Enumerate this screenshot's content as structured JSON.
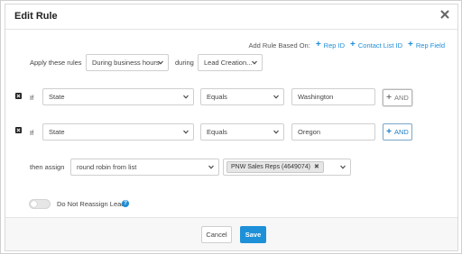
{
  "dialog": {
    "title": "Edit Rule"
  },
  "add_rule": {
    "label": "Add Rule Based On:",
    "links": [
      "Rep ID",
      "Contact List ID",
      "Rep Field"
    ]
  },
  "apply": {
    "label": "Apply these rules",
    "hours_value": "During business hours",
    "during_label": "during",
    "during_value": "Lead Creation..."
  },
  "conditions": [
    {
      "if_label": "If",
      "field": "State",
      "operator": "Equals",
      "value": "Washington",
      "and_label": "AND"
    },
    {
      "if_label": "If",
      "field": "State",
      "operator": "Equals",
      "value": "Oregon",
      "and_label": "AND"
    }
  ],
  "assign": {
    "label": "then assign",
    "method": "round robin from list",
    "tag": "PNW Sales Reps (4649074)"
  },
  "reassign": {
    "label": "Do Not Reassign Lead",
    "enabled": false
  },
  "footer": {
    "cancel": "Cancel",
    "save": "Save"
  },
  "colors": {
    "accent": "#1e90d8",
    "link": "#1f8dd6"
  }
}
